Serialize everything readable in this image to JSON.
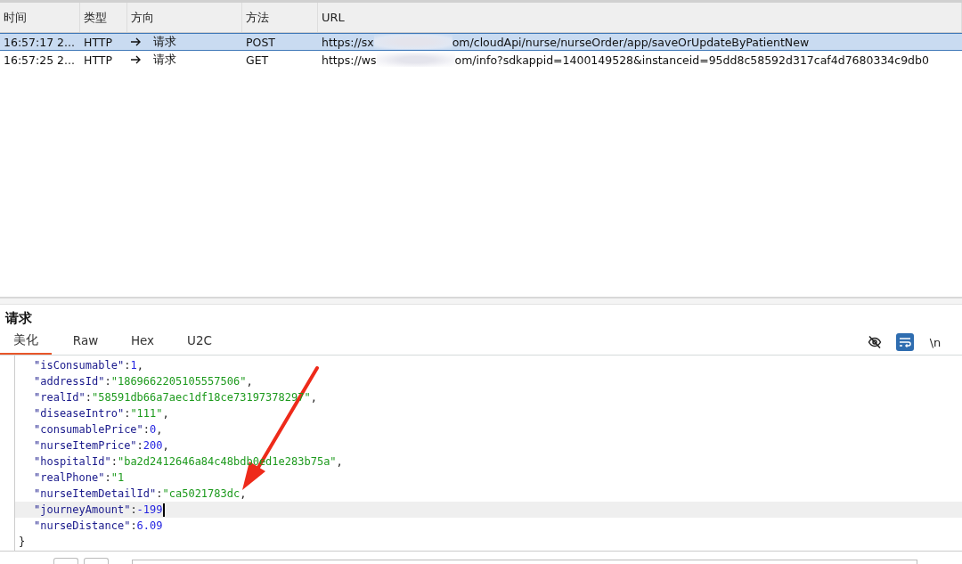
{
  "table": {
    "columns": [
      "时间",
      "类型",
      "方向",
      "方法",
      "URL"
    ],
    "rows": [
      {
        "time": "16:57:17 2...",
        "type": "HTTP",
        "direction": "请求",
        "method": "POST",
        "url": [
          "https://sx",
          "om/cloudApi/nurse/nurseOrder/app/saveOrUpdateByPatientNew"
        ],
        "selected": true
      },
      {
        "time": "16:57:25 2...",
        "type": "HTTP",
        "direction": "请求",
        "method": "GET",
        "url": [
          "https://ws",
          "om/info?sdkappid=1400149528&instanceid=95dd8c58592d317caf4d7680334c9db0"
        ],
        "selected": false
      }
    ]
  },
  "request": {
    "title": "请求",
    "tabs": [
      {
        "label": "美化",
        "selected": true
      },
      {
        "label": "Raw",
        "selected": false
      },
      {
        "label": "Hex",
        "selected": false
      },
      {
        "label": "U2C",
        "selected": false
      }
    ],
    "tools": [
      {
        "kind": "hide",
        "on": false
      },
      {
        "kind": "wrap",
        "on": true
      },
      {
        "kind": "text",
        "label": "\\n",
        "on": false
      }
    ],
    "lines": [
      {
        "key": "\"isConsumable\"",
        "kind": "number",
        "value": "1",
        "tail": ",",
        "current": false
      },
      {
        "key": "\"addressId\"",
        "kind": "string",
        "value": "\"1869662205105557506\"",
        "tail": ",",
        "current": false
      },
      {
        "key": "\"realId\"",
        "kind": "string",
        "value": "\"58591db66a7aec1df18ce73197378297\"",
        "tail": ",",
        "current": false
      },
      {
        "key": "\"diseaseIntro\"",
        "kind": "string",
        "value": "\"111\"",
        "tail": ",",
        "current": false
      },
      {
        "key": "\"consumablePrice\"",
        "kind": "number",
        "value": "0",
        "tail": ",",
        "current": false
      },
      {
        "key": "\"nurseItemPrice\"",
        "kind": "number",
        "value": "200",
        "tail": ",",
        "current": false
      },
      {
        "key": "\"hospitalId\"",
        "kind": "string",
        "value": "\"ba2d2412646a84c48bdb0ed1e283b75a\"",
        "tail": ",",
        "current": false
      },
      {
        "key": "\"realPhone\"",
        "kind": "string",
        "value": "\"1",
        "current": false
      },
      {
        "key": "\"nurseItemDetailId\"",
        "kind": "string",
        "value": "\"ca5021783dc",
        "tail": ",",
        "current": false
      },
      {
        "key": "\"journeyAmount\"",
        "kind": "number",
        "value": "-199",
        "current": true
      },
      {
        "key": "\"nurseDistance\"",
        "kind": "number",
        "value": "6.09",
        "current": false
      }
    ],
    "separator": ":",
    "closing": "}"
  },
  "annotation": {
    "kind": "arrow"
  }
}
